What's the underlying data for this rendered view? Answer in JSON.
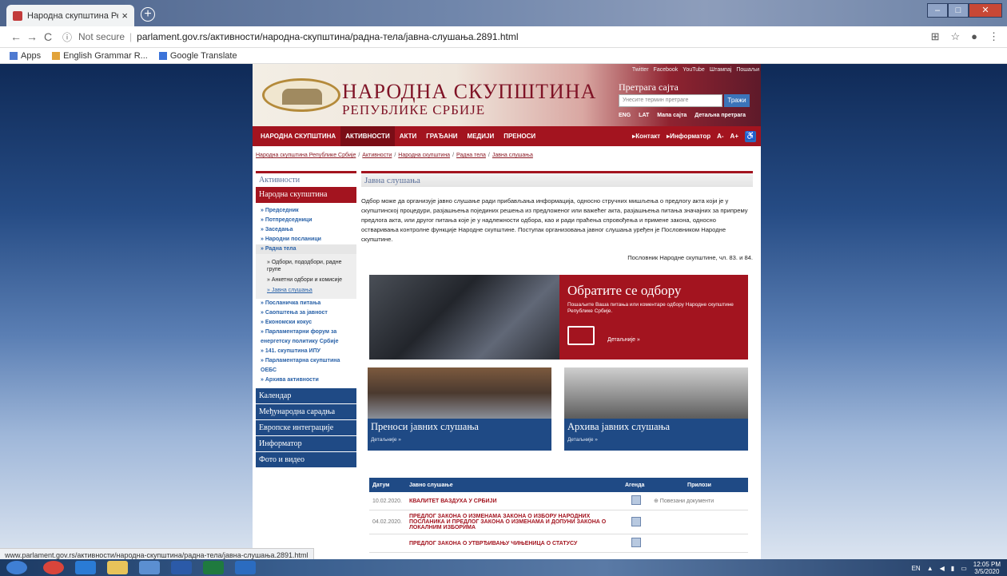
{
  "browser": {
    "tab_title": "Народна скупштина Републике",
    "new_tab": "+",
    "not_secure": "Not secure",
    "url": "parlament.gov.rs/активности/народна-скупштина/радна-тела/јавна-слушања.2891.html",
    "bookmarks": [
      "Apps",
      "English Grammar R...",
      "Google Translate"
    ],
    "status_url": "www.parlament.gov.rs/активности/народна-скупштина/радна-тела/јавна-слушања.2891.html"
  },
  "header": {
    "title1": "НАРОДНА СКУПШТИНА",
    "title2": "РЕПУБЛИКЕ СРБИЈЕ",
    "social": [
      "Twitter",
      "Facebook",
      "YouTube",
      "Штампај",
      "Пошаљи"
    ],
    "search_title": "Претрага сајта",
    "search_placeholder": "Унесите термин претраге",
    "search_button": "Тражи",
    "top_links": [
      "ENG",
      "LAT",
      "Мапа сајта",
      "Детаљна претрага"
    ]
  },
  "mainnav": {
    "items": [
      "НАРОДНА СКУПШТИНА",
      "АКТИВНОСТИ",
      "АКТИ",
      "ГРАЂАНИ",
      "МЕДИЈИ",
      "ПРЕНОСИ"
    ],
    "contact": "▸Контакт",
    "informator": "▸Информатор",
    "font_small": "A-",
    "font_big": "A+"
  },
  "breadcrumbs": [
    "Народна скупштина Републике Србије",
    "Активности",
    "Народна скупштина",
    "Радна тела",
    "Јавна слушања"
  ],
  "sidebar": {
    "heading": "Активности",
    "section": "Народна скупштина",
    "items": [
      "» Председник",
      "» Потпредседници",
      "» Заседања",
      "» Народни посланици",
      "» Радна тела"
    ],
    "sub": [
      "» Одбори, пододбори, радне групе",
      "» Анкетни одбори и комисије",
      "» Јавна слушања"
    ],
    "items2": [
      "» Посланичка питања",
      "» Саопштења за јавност",
      "» Економски кокус",
      "» Парламентарни форум за енергетску политику Србије",
      "» 141. скупштина ИПУ",
      "» Парламентарна скупштина ОЕБС",
      "» Архива активности"
    ],
    "blue": [
      "Календар",
      "Међународна сарадња",
      "Европске интеграције",
      "Информатор",
      "Фото и видео"
    ]
  },
  "main": {
    "heading": "Јавна слушања",
    "intro": "Одбор може да организује јавно слушање ради прибављања информација, односно стручних мишљења о предлогу акта који је у скупштинској процедури, разјашњења појединих решења из предложеног или важећег акта, разјашњења питања значајних за припрему предлога акта, или другог питања које је у надлежности одбора, као и ради праћења спровођења и примене закона, односно остваривања контролне функције Народне скупштине. Поступак организовања јавног слушања уређен је Пословником Народне скупштине.",
    "reference": "Пословник Народне скупштине, чл. 83. и 84.",
    "banner_title": "Обратите се одбору",
    "banner_text": "Пошаљите Ваша питања или коментаре одбору Народне скупштине Републике Србије.",
    "banner_more": "Детаљније »",
    "tile1_title": "Преноси јавних слушања",
    "tile2_title": "Архива јавних слушања",
    "tile_more": "Детаљније »"
  },
  "table": {
    "headers": [
      "Датум",
      "Јавно слушање",
      "Агенда",
      "Прилози"
    ],
    "rows": [
      {
        "date": "10.02.2020.",
        "title": "КВАЛИТЕТ ВАЗДУХА У СРБИЈИ",
        "attach": "⊕ Повезани документи"
      },
      {
        "date": "04.02.2020.",
        "title": "ПРЕДЛОГ ЗАКОНА О ИЗМЕНАМА ЗАКОНА О ИЗБОРУ НАРОДНИХ ПОСЛАНИКА И ПРЕДЛОГ ЗАКОНА О ИЗМЕНАМА И ДОПУНИ ЗАКОНА О ЛОКАЛНИМ ИЗБОРИМА",
        "attach": ""
      },
      {
        "date": "",
        "title": "ПРЕДЛОГ ЗАКОНА О УТВРЂИВАЊУ ЧИЊЕНИЦА О СТАТУСУ",
        "attach": ""
      }
    ]
  },
  "taskbar": {
    "lang": "EN",
    "time": "12:05 PM",
    "date": "3/5/2020"
  }
}
